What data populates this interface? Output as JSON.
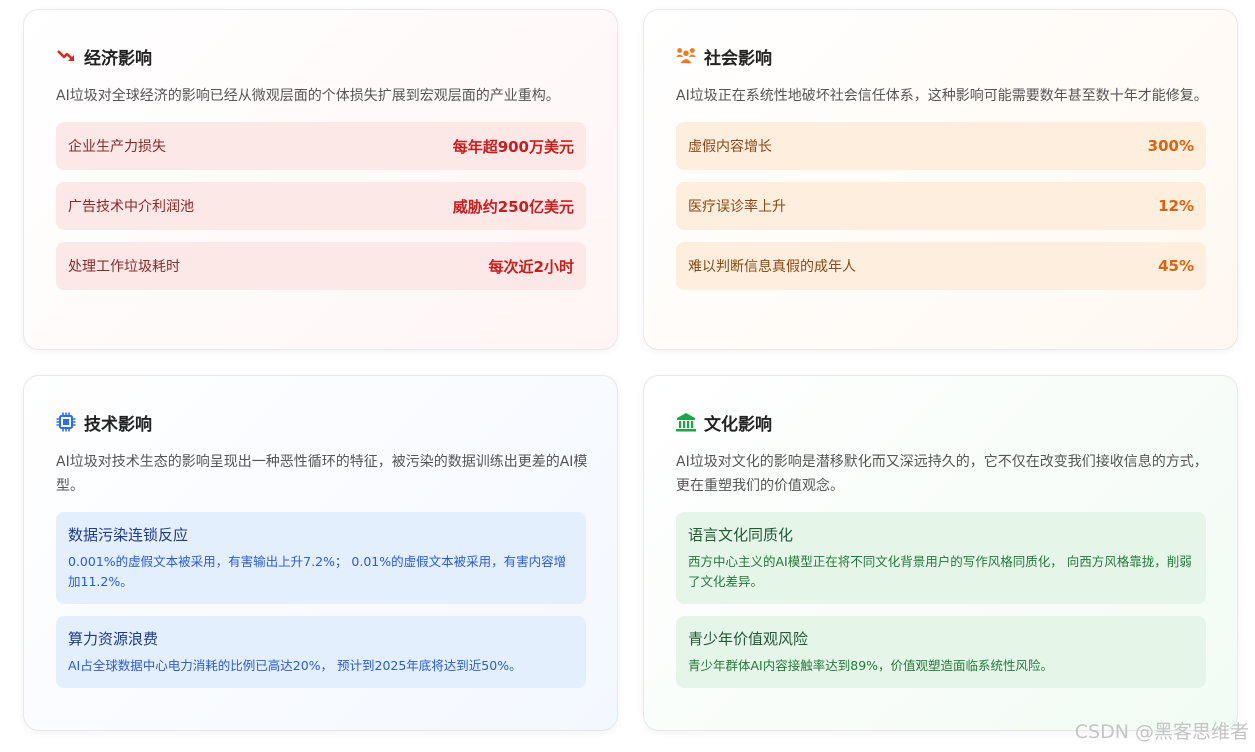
{
  "econ": {
    "title": "经济影响",
    "icon": "trend-down-icon",
    "accent": "#c81e1e",
    "description": "AI垃圾对全球经济的影响已经从微观层面的个体损失扩展到宏观层面的产业重构。",
    "stats": [
      {
        "label": "企业生产力损失",
        "value": "每年超900万美元"
      },
      {
        "label": "广告技术中介利润池",
        "value": "威胁约250亿美元"
      },
      {
        "label": "处理工作垃圾耗时",
        "value": "每次近2小时"
      }
    ]
  },
  "social": {
    "title": "社会影响",
    "icon": "people-icon",
    "accent": "#e0620e",
    "description": "AI垃圾正在系统性地破坏社会信任体系，这种影响可能需要数年甚至数十年才能修复。",
    "stats": [
      {
        "label": "虚假内容增长",
        "value": "300%"
      },
      {
        "label": "医疗误诊率上升",
        "value": "12%"
      },
      {
        "label": "难以判断信息真假的成年人",
        "value": "45%"
      }
    ]
  },
  "tech": {
    "title": "技术影响",
    "icon": "chip-icon",
    "accent": "#2a5bd7",
    "description": "AI垃圾对技术生态的影响呈现出一种恶性循环的特征，被污染的数据训练出更差的AI模型。",
    "boxes": [
      {
        "title": "数据污染连锁反应",
        "text": "0.001%的虚假文本被采用，有害输出上升7.2%； 0.01%的虚假文本被采用，有害内容增加11.2%。"
      },
      {
        "title": "算力资源浪费",
        "text": "AI占全球数据中心电力消耗的比例已高达20%， 预计到2025年底将达到近50%。"
      }
    ]
  },
  "culture": {
    "title": "文化影响",
    "icon": "museum-icon",
    "accent": "#237a3b",
    "description": "AI垃圾对文化的影响是潜移默化而又深远持久的，它不仅在改变我们接收信息的方式，更在重塑我们的价值观念。",
    "boxes": [
      {
        "title": "语言文化同质化",
        "text": "西方中心主义的AI模型正在将不同文化背景用户的写作风格同质化， 向西方风格靠拢，削弱了文化差异。"
      },
      {
        "title": "青少年价值观风险",
        "text": "青少年群体AI内容接触率达到89%，价值观塑造面临系统性风险。"
      }
    ]
  },
  "watermark": "CSDN @黑客思维者"
}
